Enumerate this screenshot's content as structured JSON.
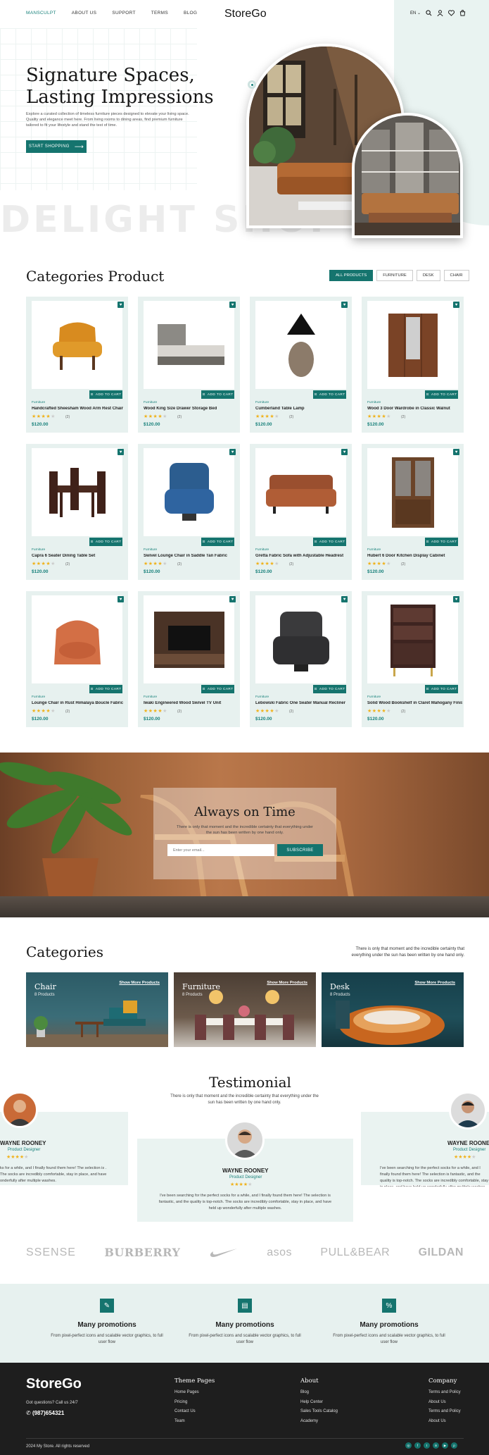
{
  "header": {
    "nav": [
      "MANSCULPT",
      "ABOUT US",
      "SUPPORT",
      "TERMS",
      "BLOG"
    ],
    "logo": "StoreGo",
    "lang": "EN ⌄"
  },
  "hero": {
    "title_line1": "Signature Spaces,",
    "title_line2": "Lasting Impressions",
    "description": "Explore a curated collection of timeless furniture pieces designed to elevate your living space. Quality and elegance meet here. From living rooms to dining areas, find premium furniture tailored to fit your lifestyle and stand the test of time.",
    "button": "START SHOPPING",
    "watermark": "DELIGHT SHOP"
  },
  "products_section": {
    "title": "Categories Product",
    "tabs": [
      "ALL PRODUCTS",
      "FURNITURE",
      "DESK",
      "CHAIR"
    ],
    "add_label": "ADD TO CART",
    "items": [
      {
        "category": "Furniture",
        "name": "Handcrafted Sheesham Wood Arm Rest Chair",
        "rating": 4,
        "reviews": "(2)",
        "price": "$120.00"
      },
      {
        "category": "Furniture",
        "name": "Wood King Size Drawer Storage Bed",
        "rating": 4,
        "reviews": "(2)",
        "price": "$120.00"
      },
      {
        "category": "Furniture",
        "name": "Cumberland Table Lamp",
        "rating": 4,
        "reviews": "(2)",
        "price": "$120.00"
      },
      {
        "category": "Furniture",
        "name": "Wood 3 Door Wardrobe in Classic Walnut",
        "rating": 4,
        "reviews": "(2)",
        "price": "$120.00"
      },
      {
        "category": "Furniture",
        "name": "Capra 6 Seater Dining Table Set",
        "rating": 4,
        "reviews": "(2)",
        "price": "$120.00"
      },
      {
        "category": "Furniture",
        "name": "Swivel Lounge Chair in Saddle Tan Fabric",
        "rating": 4,
        "reviews": "(2)",
        "price": "$120.00"
      },
      {
        "category": "Furniture",
        "name": "Gretta Fabric Sofa with Adjustable Headrest",
        "rating": 4,
        "reviews": "(2)",
        "price": "$120.00"
      },
      {
        "category": "Furniture",
        "name": "Hubert 6 Door Kitchen Display Cabinet",
        "rating": 4,
        "reviews": "(2)",
        "price": "$120.00"
      },
      {
        "category": "Furniture",
        "name": "Lounge Chair in Rust Himalaya Boucle Fabric",
        "rating": 4,
        "reviews": "(2)",
        "price": "$120.00"
      },
      {
        "category": "Furniture",
        "name": "Iwaki Engineered Wood Swivel TV Unit",
        "rating": 4,
        "reviews": "(2)",
        "price": "$120.00"
      },
      {
        "category": "Furniture",
        "name": "Lebowski Fabric One Seater Manual Recliner",
        "rating": 4,
        "reviews": "(2)",
        "price": "$120.00"
      },
      {
        "category": "Furniture",
        "name": "Solid Wood Bookshelf in Claret Mahogany Finish",
        "rating": 4,
        "reviews": "(2)",
        "price": "$120.00"
      }
    ]
  },
  "newsletter": {
    "title": "Always on Time",
    "description": "There is only that moment and the incredible certainty that everything under the sun has been written by one hand only.",
    "placeholder": "Enter your email...",
    "button": "SUBSCRIBE"
  },
  "categories": {
    "title": "Categories",
    "description": "There is only that moment and the incredible certainty that everything under the sun has been written by one hand only.",
    "items": [
      {
        "name": "Chair",
        "count": "8 Products",
        "link": "Show More Products"
      },
      {
        "name": "Furniture",
        "count": "8 Products",
        "link": "Show More Products"
      },
      {
        "name": "Desk",
        "count": "8 Products",
        "link": "Show More Products"
      }
    ]
  },
  "testimonial": {
    "title": "Testimonial",
    "description": "There is only that moment and the incredible certainty that everything under the sun has been written by one hand only.",
    "name": "WAYNE ROONEY",
    "role": "Product Designer",
    "text": "I've been searching for the perfect socks for a while, and I finally found them here! The selection is fantastic, and the quality is top-notch. The socks are incredibly comfortable, stay in place, and have held up wonderfully after multiple washes.",
    "left_text": "ks for a while, and I finally found them here! The selection is . The socks are incredibly comfortable, stay in place, and have onderfully after multiple washes.",
    "right_text": "I've been searching for the perfect socks for a while, and I finally found them here! The selection is fantastic, and the quality is top-notch. The socks are incredibly comfortable, stay in place, and have held up wonderfully after multiple washes."
  },
  "brands": [
    "SSENSE",
    "BURBERRY",
    "NIKE",
    "ASOS",
    "PULL&BEAR",
    "GILDAN"
  ],
  "promos": [
    {
      "icon": "tag-icon",
      "title": "Many promotions",
      "text": "From pixel-perfect icons and scalable vector graphics, to full user flow"
    },
    {
      "icon": "store-icon",
      "title": "Many promotions",
      "text": "From pixel-perfect icons and scalable vector graphics, to full user flow"
    },
    {
      "icon": "percent-icon",
      "title": "Many promotions",
      "text": "From pixel-perfect icons and scalable vector graphics, to full user flow"
    }
  ],
  "footer": {
    "logo": "StoreGo",
    "question": "Got questions? Call us 24/7",
    "phone": "(987)654321",
    "columns": [
      {
        "title": "Theme Pages",
        "links": [
          "Home Pages",
          "Pricing",
          "Contact Us",
          "Team"
        ]
      },
      {
        "title": "About",
        "links": [
          "Blog",
          "Help Center",
          "Sales Tools Catalog",
          "Academy"
        ]
      },
      {
        "title": "Company",
        "links": [
          "Terms and Policy",
          "About Us",
          "Terms and Policy",
          "About Us"
        ]
      }
    ],
    "copyright": "2024 My Store. All rights reserved"
  },
  "colors": {
    "accent": "#15746e",
    "light_bg": "#e7f1ef",
    "footer_bg": "#1e1e1e",
    "star": "#f0b21c"
  }
}
